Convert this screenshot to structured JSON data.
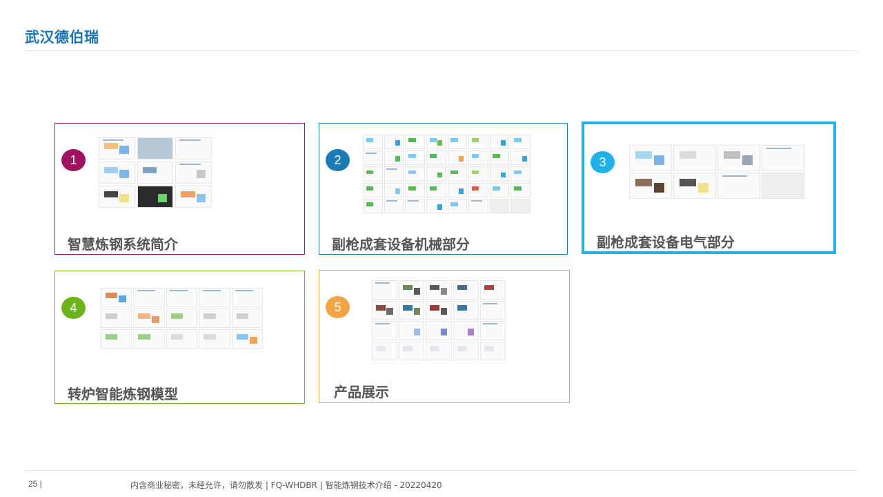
{
  "header": {
    "brand": "武汉德伯瑞"
  },
  "cards": [
    {
      "number": "1",
      "title": "智慧炼钢系统简介",
      "color": "#a0115f",
      "accent": "#5aa7e0"
    },
    {
      "number": "2",
      "title": "副枪成套设备机械部分",
      "color": "#1b7bb5",
      "accent": "#49b24a"
    },
    {
      "number": "3",
      "title": "副枪成套设备电气部分",
      "color": "#1fb1e8",
      "accent": "#6c8ca8"
    },
    {
      "number": "4",
      "title": "转炉智能炼钢模型",
      "color": "#6db31a",
      "accent": "#6cc27a"
    },
    {
      "number": "5",
      "title": "产品展示",
      "color": "#f0a444",
      "accent": "#8a6d5a"
    }
  ],
  "footer": {
    "page": "25 |",
    "text": "内含商业秘密，未经允许，请勿散发 | FQ-WHDBR | 智能炼钢技术介绍 - 20220420"
  }
}
